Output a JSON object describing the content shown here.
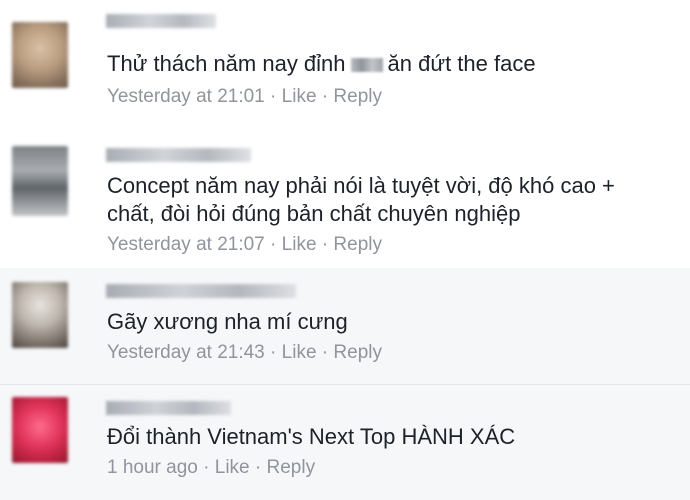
{
  "comments": [
    {
      "text_before": "Thử thách năm nay đỉnh",
      "text_after": "ăn đứt the face",
      "time": "Yesterday at 21:01",
      "like": "Like",
      "reply": "Reply"
    },
    {
      "line1": "Concept năm nay phải nói là tuyệt vời, độ khó cao +",
      "line2": "chất, đòi hỏi đúng bản chất chuyên nghiệp",
      "time": "Yesterday at 21:07",
      "like": "Like",
      "reply": "Reply"
    },
    {
      "text": "Gãy xương nha mí cưng",
      "time": "Yesterday at 21:43",
      "like": "Like",
      "reply": "Reply"
    },
    {
      "text": "Đổi thành Vietnam's Next Top HÀNH XÁC",
      "time": "1 hour ago",
      "like": "Like",
      "reply": "Reply"
    }
  ],
  "separator": "·"
}
